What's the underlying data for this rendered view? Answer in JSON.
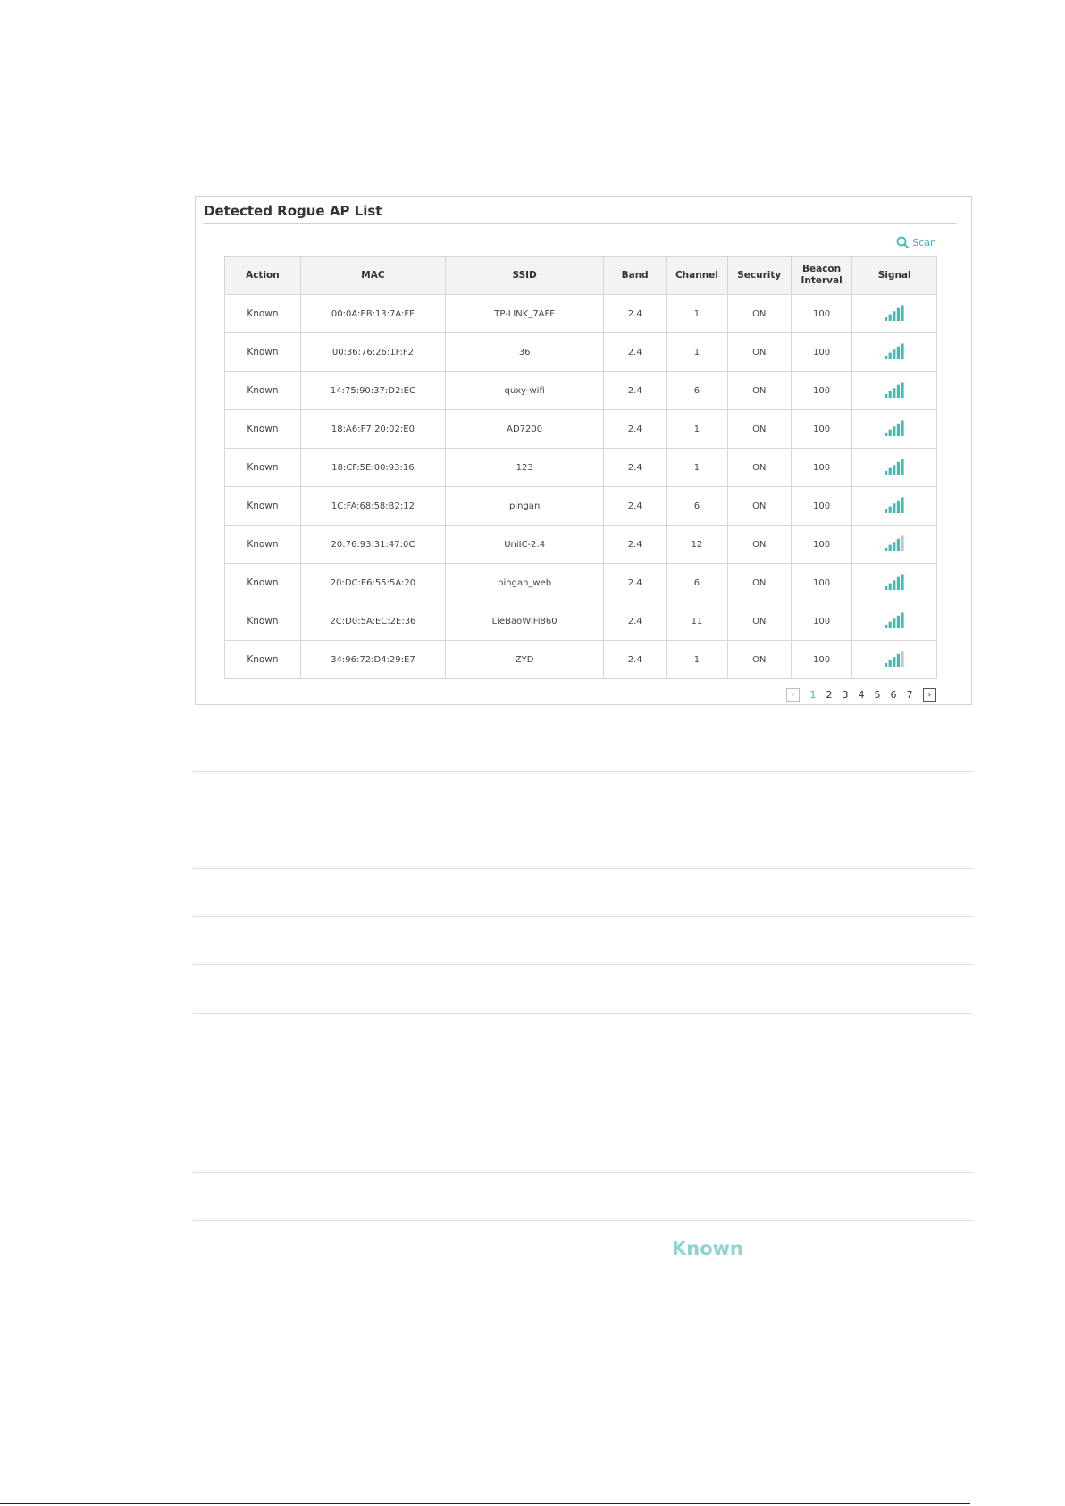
{
  "panel": {
    "title": "Detected Rogue AP List",
    "scan_label": "Scan"
  },
  "table": {
    "headers": {
      "action": "Action",
      "mac": "MAC",
      "ssid": "SSID",
      "band": "Band",
      "channel": "Channel",
      "security": "Security",
      "beacon_1": "Beacon",
      "beacon_2": "Interval",
      "signal": "Signal"
    },
    "rows": [
      {
        "action": "Known",
        "mac": "00:0A:EB:13:7A:FF",
        "ssid": "TP-LINK_7AFF",
        "band": "2.4",
        "channel": "1",
        "security": "ON",
        "beacon": "100",
        "signal_bars": 5
      },
      {
        "action": "Known",
        "mac": "00:36:76:26:1F:F2",
        "ssid": "36",
        "band": "2.4",
        "channel": "1",
        "security": "ON",
        "beacon": "100",
        "signal_bars": 5
      },
      {
        "action": "Known",
        "mac": "14:75:90:37:D2:EC",
        "ssid": "quxy-wifi",
        "band": "2.4",
        "channel": "6",
        "security": "ON",
        "beacon": "100",
        "signal_bars": 5
      },
      {
        "action": "Known",
        "mac": "18:A6:F7:20:02:E0",
        "ssid": "AD7200",
        "band": "2.4",
        "channel": "1",
        "security": "ON",
        "beacon": "100",
        "signal_bars": 5
      },
      {
        "action": "Known",
        "mac": "18:CF:5E:00:93:16",
        "ssid": "123",
        "band": "2.4",
        "channel": "1",
        "security": "ON",
        "beacon": "100",
        "signal_bars": 5
      },
      {
        "action": "Known",
        "mac": "1C:FA:68:58:B2:12",
        "ssid": "pingan",
        "band": "2.4",
        "channel": "6",
        "security": "ON",
        "beacon": "100",
        "signal_bars": 5
      },
      {
        "action": "Known",
        "mac": "20:76:93:31:47:0C",
        "ssid": "UniIC-2.4",
        "band": "2.4",
        "channel": "12",
        "security": "ON",
        "beacon": "100",
        "signal_bars": 4
      },
      {
        "action": "Known",
        "mac": "20:DC:E6:55:5A:20",
        "ssid": "pingan_web",
        "band": "2.4",
        "channel": "6",
        "security": "ON",
        "beacon": "100",
        "signal_bars": 5
      },
      {
        "action": "Known",
        "mac": "2C:D0:5A:EC:2E:36",
        "ssid": "LieBaoWiFi860",
        "band": "2.4",
        "channel": "11",
        "security": "ON",
        "beacon": "100",
        "signal_bars": 5
      },
      {
        "action": "Known",
        "mac": "34:96:72:D4:29:E7",
        "ssid": "ZYD",
        "band": "2.4",
        "channel": "1",
        "security": "ON",
        "beacon": "100",
        "signal_bars": 4
      }
    ]
  },
  "pagination": {
    "pages": [
      "1",
      "2",
      "3",
      "4",
      "5",
      "6",
      "7"
    ],
    "current": "1"
  },
  "known_label": "Known",
  "colors": {
    "accent": "#3fb8c2",
    "signal_on": "#3dbdb6",
    "signal_off": "#c4c4c4"
  },
  "icons": {
    "scan": "search-icon",
    "prev": "chevron-left-icon",
    "next": "chevron-right-icon",
    "signal": "signal-strength-icon"
  }
}
